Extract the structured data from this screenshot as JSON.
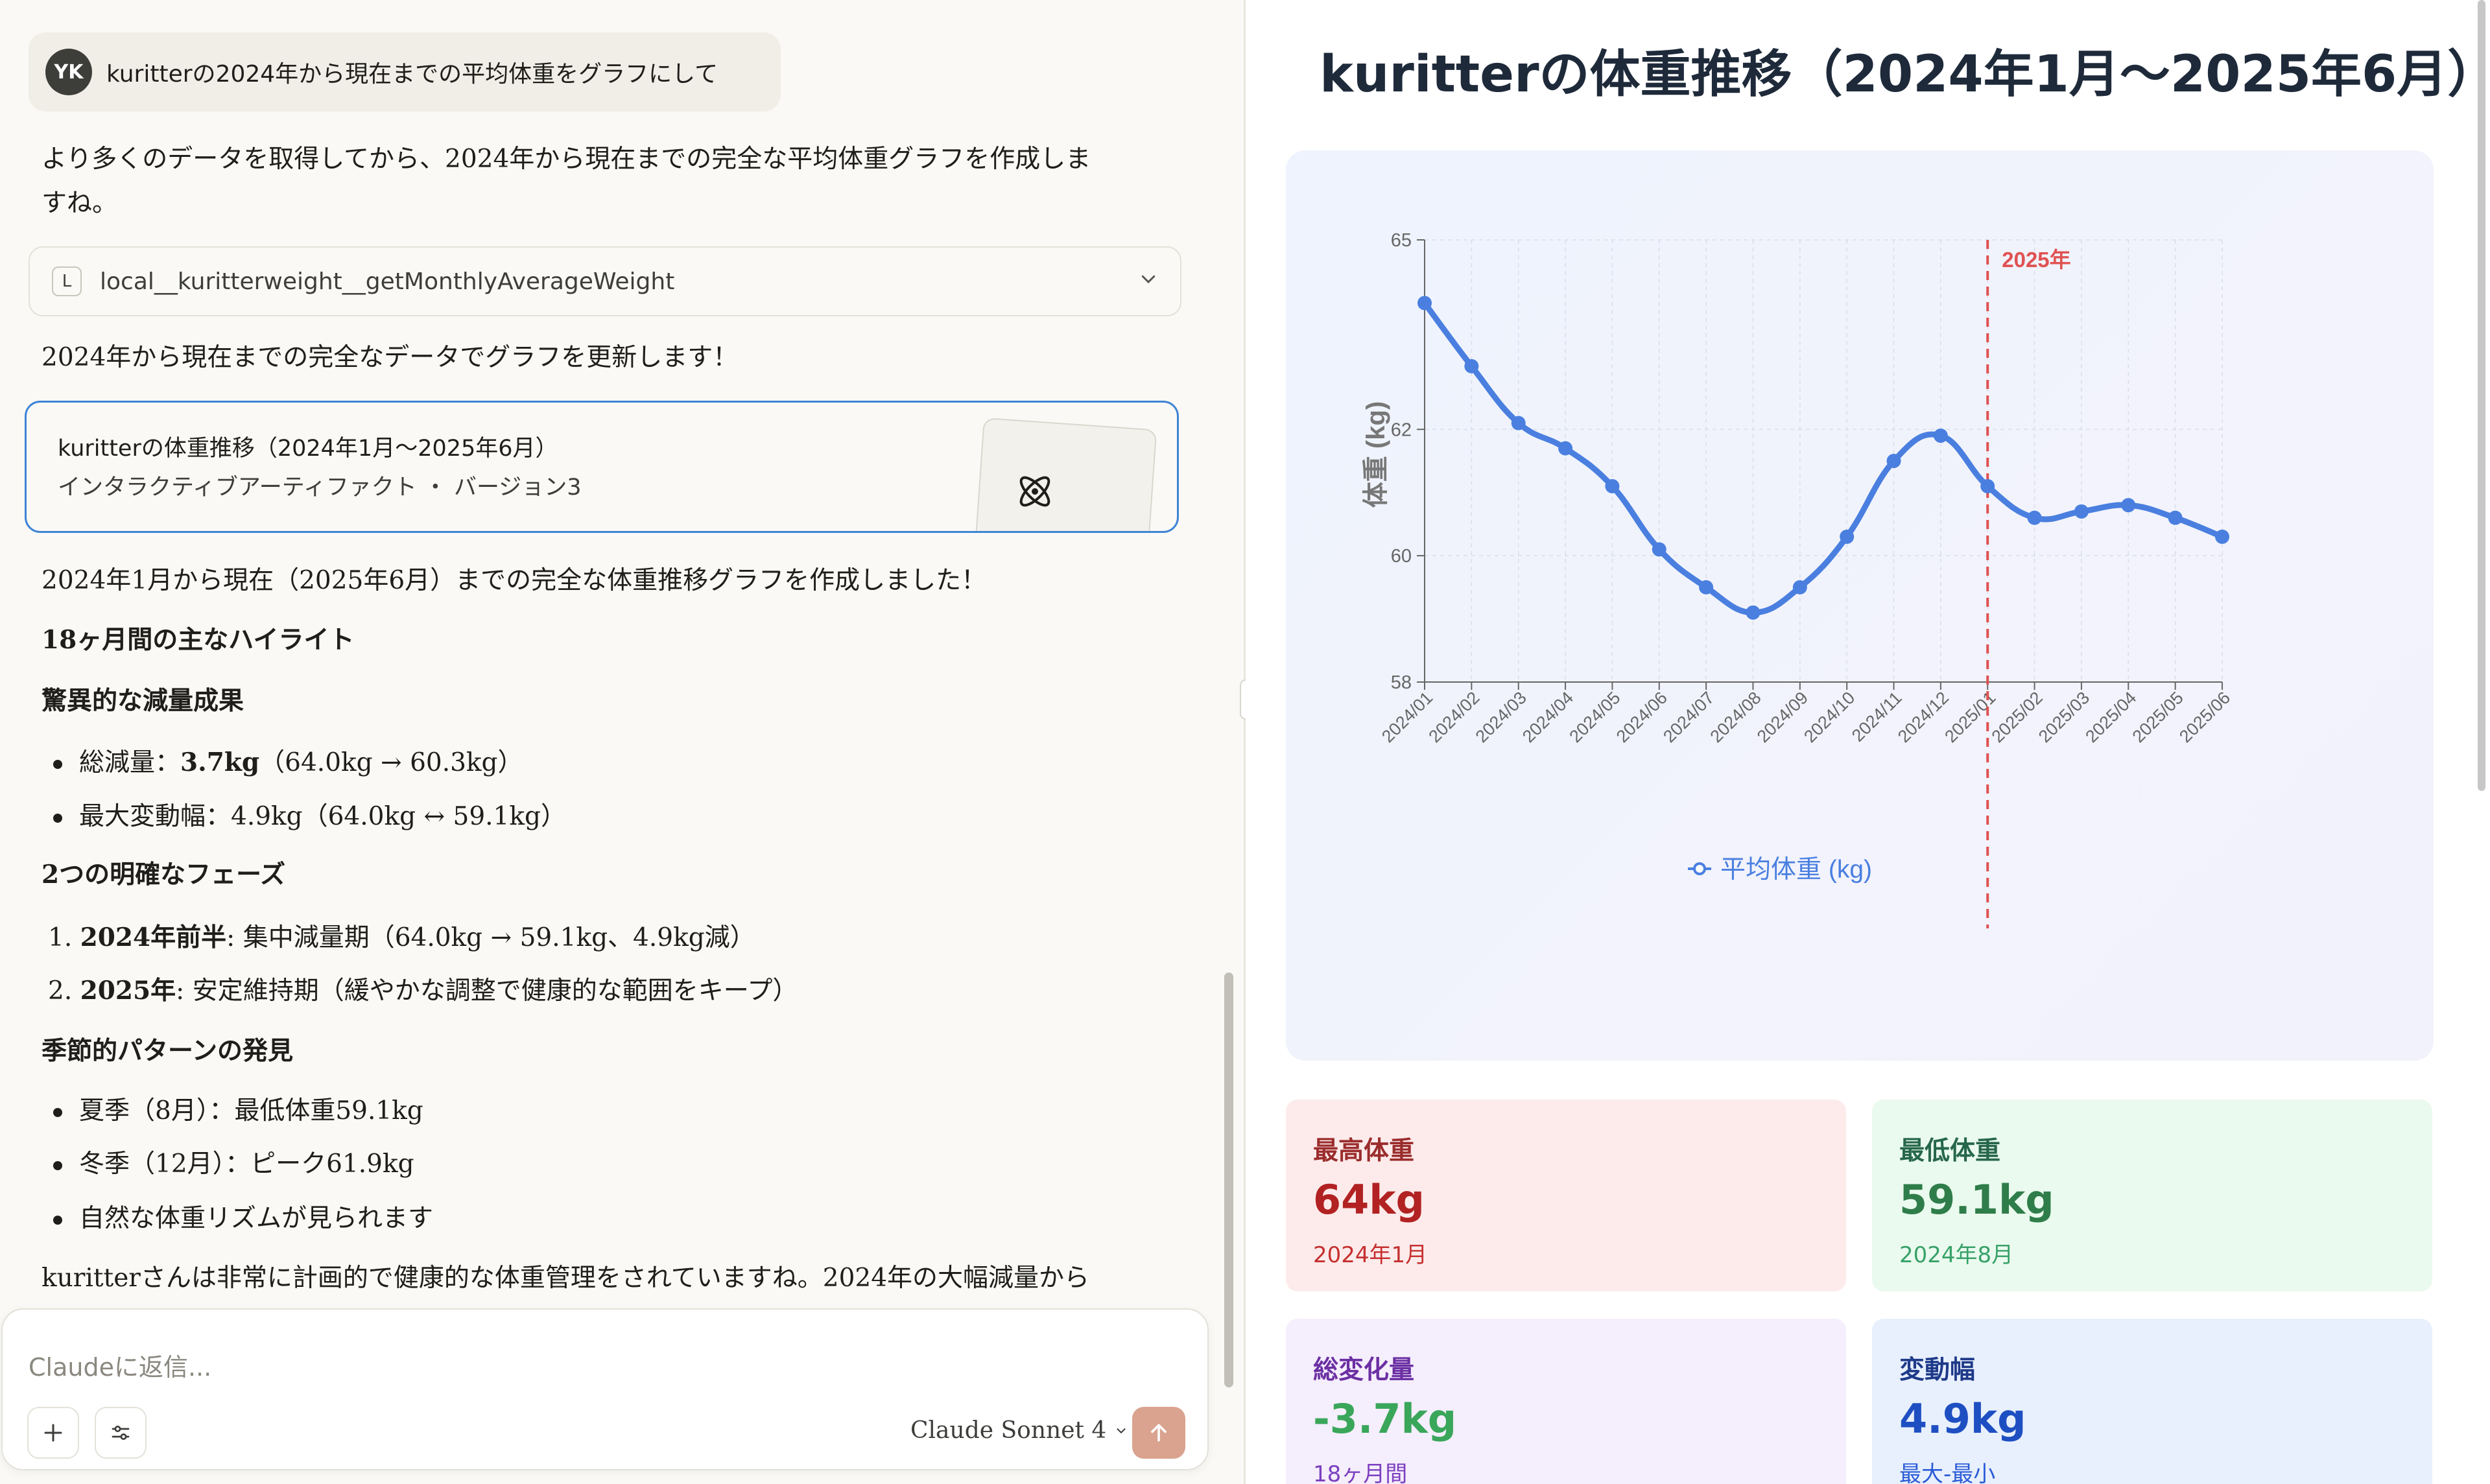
{
  "chat": {
    "user": {
      "avatar_initials": "YK",
      "message": "kuritterの2024年から現在までの平均体重をグラフにして"
    },
    "reply_intro_line1": "より多くのデータを取得してから、2024年から現在までの完全な平均体重グラフを作成しま",
    "reply_intro_line2": "すね。",
    "tool_call": {
      "badge": "L",
      "name": "local__kuritterweight__getMonthlyAverageWeight"
    },
    "update_note": "2024年から現在までの完全なデータでグラフを更新します！",
    "artifact_card": {
      "title": "kuritterの体重推移（2024年1月〜2025年6月）",
      "subtitle": "インタラクティブアーティファクト ・ バージョン3"
    },
    "summary": "2024年1月から現在（2025年6月）までの完全な体重推移グラフを作成しました！",
    "h_highlights": "18ヶ月間の主なハイライト",
    "h_loss": "驚異的な減量成果",
    "loss_items": [
      {
        "label": "総減量：",
        "bold": "3.7kg",
        "rest": "（64.0kg → 60.3kg）"
      },
      {
        "label": "最大変動幅：4.9kg（64.0kg ↔ 59.1kg）",
        "bold": "",
        "rest": ""
      }
    ],
    "h_phases": "2つの明確なフェーズ",
    "phases": [
      {
        "num": "1.",
        "bold": "2024年前半",
        "rest": ": 集中減量期（64.0kg → 59.1kg、4.9kg減）"
      },
      {
        "num": "2.",
        "bold": "2025年",
        "rest": ": 安定維持期（緩やかな調整で健康的な範囲をキープ）"
      }
    ],
    "h_season": "季節的パターンの発見",
    "season_items": [
      "夏季（8月）：最低体重59.1kg",
      "冬季（12月）：ピーク61.9kg",
      "自然な体重リズムが見られます"
    ],
    "closing": "kuritterさんは非常に計画的で健康的な体重管理をされていますね。2024年の大幅減量から",
    "composer": {
      "placeholder": "Claudeに返信...",
      "add_icon": "plus-icon",
      "tools_icon": "sliders-icon",
      "model": "Claude Sonnet 4",
      "send_icon": "arrow-up-icon"
    }
  },
  "artifact": {
    "title": "kuritterの体重推移（2024年1月〜2025年6月）",
    "stats": [
      {
        "label": "最高体重",
        "value": "64kg",
        "sub": "2024年1月",
        "bg": "#fdebeb",
        "label_color": "#9b2c2c",
        "value_color": "#b22222",
        "sub_color": "#c53030"
      },
      {
        "label": "最低体重",
        "value": "59.1kg",
        "sub": "2024年8月",
        "bg": "#eafaee",
        "label_color": "#276749",
        "value_color": "#2f7d4a",
        "sub_color": "#38a169"
      },
      {
        "label": "総変化量",
        "value": "-3.7kg",
        "sub": "18ヶ月間",
        "bg": "#f5eefc",
        "label_color": "#6b2fa3",
        "value_color": "#3aa65a",
        "sub_color": "#7b3fbf"
      },
      {
        "label": "変動幅",
        "value": "4.9kg",
        "sub": "最大-最小",
        "bg": "#e8f0fd",
        "label_color": "#1e3a8a",
        "value_color": "#1e4fc2",
        "sub_color": "#2b5cd6"
      }
    ]
  },
  "chart_data": {
    "type": "line",
    "title": "",
    "xlabel": "",
    "ylabel": "体重 (kg)",
    "ylim": [
      58,
      65
    ],
    "yticks": [
      58,
      60,
      62,
      65
    ],
    "grid": true,
    "legend": "bottom-center",
    "annotation": {
      "label": "2025年",
      "at": "2025/01",
      "color": "#e05252"
    },
    "categories": [
      "2024/01",
      "2024/02",
      "2024/03",
      "2024/04",
      "2024/05",
      "2024/06",
      "2024/07",
      "2024/08",
      "2024/09",
      "2024/10",
      "2024/11",
      "2024/12",
      "2025/01",
      "2025/02",
      "2025/03",
      "2025/04",
      "2025/05",
      "2025/06"
    ],
    "series": [
      {
        "name": "平均体重 (kg)",
        "color": "#4a7fe0",
        "values": [
          64.0,
          63.0,
          62.1,
          61.7,
          61.1,
          60.1,
          59.5,
          59.1,
          59.5,
          60.3,
          61.5,
          61.9,
          61.1,
          60.6,
          60.7,
          60.8,
          60.6,
          60.3
        ]
      }
    ]
  }
}
